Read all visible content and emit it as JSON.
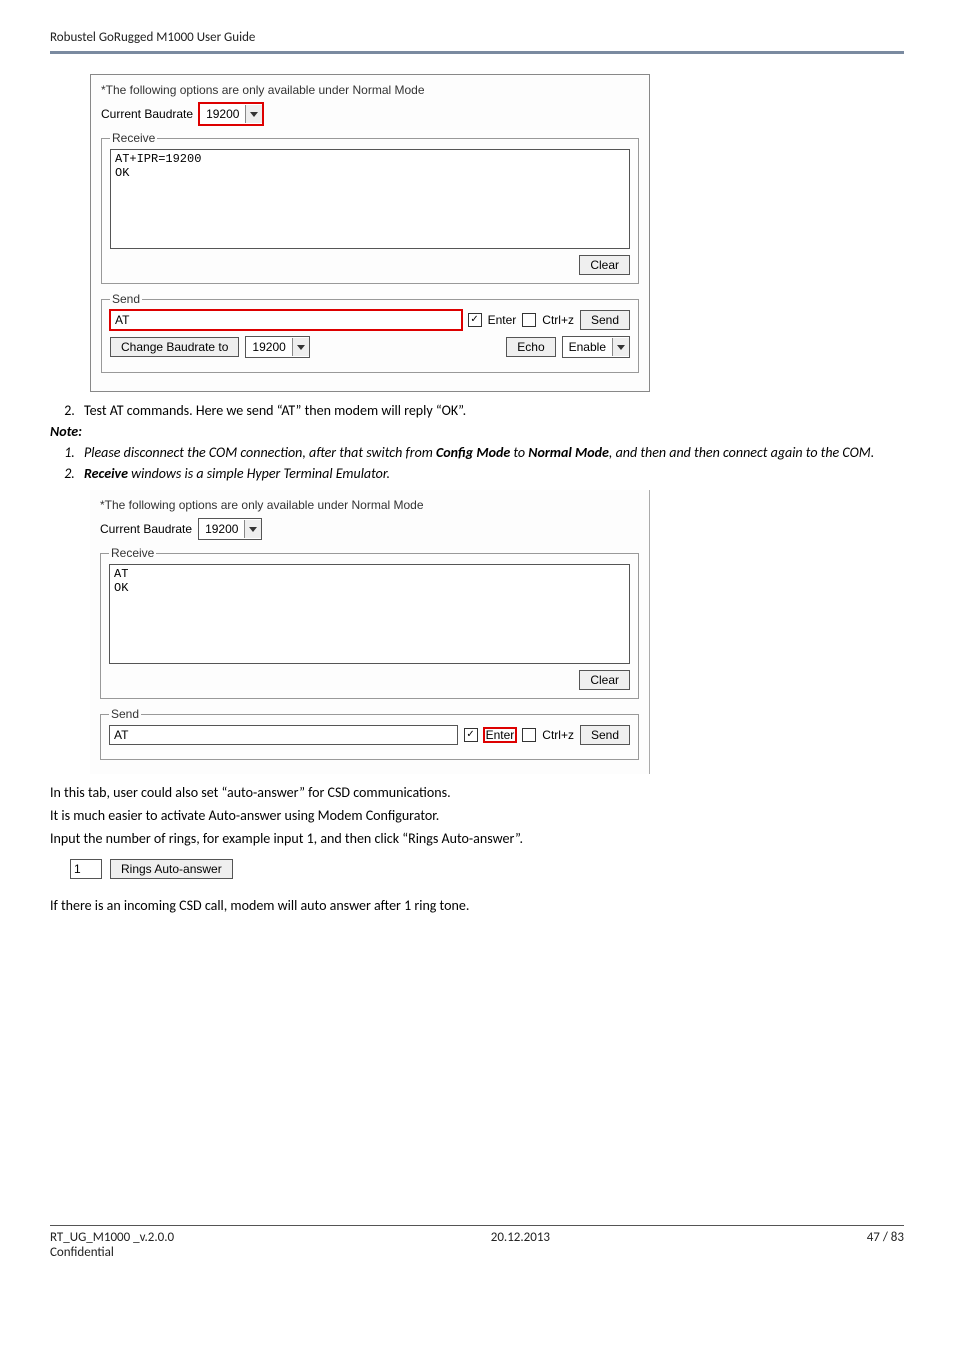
{
  "header": {
    "title": "Robustel GoRugged M1000 User Guide"
  },
  "panel1": {
    "note": "*The following options are only available under Normal Mode",
    "baud_label": "Current Baudrate",
    "baud_value": "19200",
    "receive_legend": "Receive",
    "receive_text": "AT+IPR=19200\nOK",
    "clear_label": "Clear",
    "send_legend": "Send",
    "send_value": "AT",
    "enter_label": "Enter",
    "ctrlz_label": "Ctrl+z",
    "send_btn": "Send",
    "change_baud_btn": "Change Baudrate to",
    "change_baud_value": "19200",
    "echo_btn": "Echo",
    "echo_select": "Enable"
  },
  "step2": "Test AT commands. Here we send “AT” then modem will reply “OK”.",
  "note_head": "Note:",
  "note1_a": "Please disconnect the COM connection, after that switch from ",
  "note1_b": "Config Mode",
  "note1_c": " to ",
  "note1_d": "Normal Mode",
  "note1_e": ", and then and then connect again to the COM.",
  "note2_a": "Receive",
  "note2_b": " windows is a simple Hyper Terminal Emulator.",
  "panel2": {
    "note": "*The following options are only available under Normal Mode",
    "baud_label": "Current Baudrate",
    "baud_value": "19200",
    "receive_legend": "Receive",
    "receive_text": "AT\nOK",
    "clear_label": "Clear",
    "send_legend": "Send",
    "send_value": "AT",
    "enter_label": "Enter",
    "ctrlz_label": "Ctrl+z",
    "send_btn": "Send"
  },
  "para1": "In this tab, user could also set “auto-answer” for CSD communications.",
  "para2": "It is much easier to activate Auto-answer using Modem Configurator.",
  "para3": "Input the number of rings, for example input 1, and then click “Rings Auto-answer”.",
  "rings": {
    "value": "1",
    "btn": "Rings Auto-answer"
  },
  "para4": "If there is an incoming CSD call, modem will auto answer after 1 ring tone.",
  "footer": {
    "left": "RT_UG_M1000 _v.2.0.0",
    "center": "20.12.2013",
    "right": "47 / 83",
    "conf": "Confidential"
  }
}
